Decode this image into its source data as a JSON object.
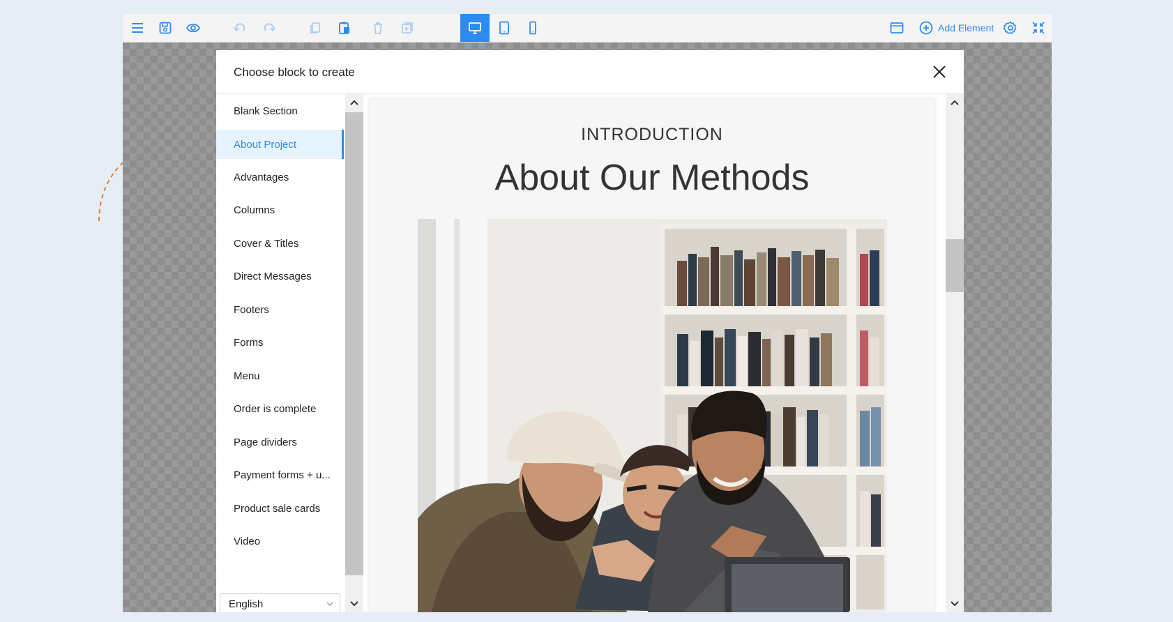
{
  "toolbar": {
    "left_icons": [
      "menu-icon",
      "save-icon",
      "eye-icon",
      "undo-icon",
      "redo-icon",
      "copy-icon",
      "paste-icon",
      "delete-icon",
      "duplicate-icon"
    ],
    "device_icons": [
      "desktop-icon",
      "tablet-icon",
      "phone-icon"
    ],
    "active_device": "desktop",
    "right_icons": [
      "browser-window-icon",
      "plus-circle-icon",
      "gear-icon",
      "collapse-icon"
    ],
    "add_element_label": "Add Element",
    "accent_color": "#2d8cf0"
  },
  "modal": {
    "title": "Choose block to create",
    "close_icon": "close-icon"
  },
  "sidebar": {
    "active_item": "About Project",
    "items": [
      {
        "label": "Blank Section"
      },
      {
        "label": "About Project"
      },
      {
        "label": "Advantages"
      },
      {
        "label": "Columns"
      },
      {
        "label": "Cover & Titles"
      },
      {
        "label": "Direct Messages"
      },
      {
        "label": "Footers"
      },
      {
        "label": "Forms"
      },
      {
        "label": "Menu"
      },
      {
        "label": "Order is complete"
      },
      {
        "label": "Page dividers"
      },
      {
        "label": "Payment forms + u..."
      },
      {
        "label": "Product sale cards"
      },
      {
        "label": "Video"
      }
    ],
    "language": "English"
  },
  "preview": {
    "kicker": "INTRODUCTION",
    "heading": "About Our Methods",
    "image": "three men laughing in front of a bookshelf"
  }
}
